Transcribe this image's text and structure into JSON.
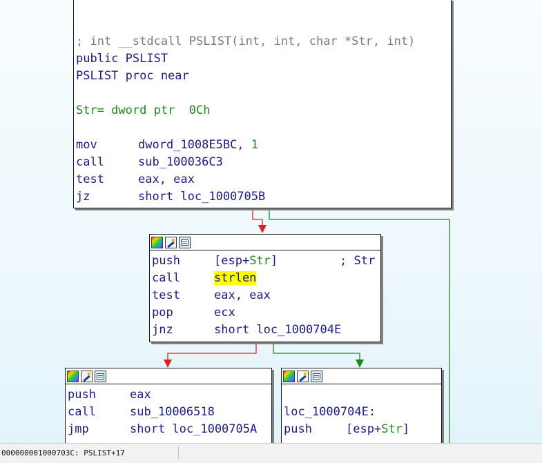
{
  "graph": {
    "top_node": {
      "signature": "; int __stdcall PSLIST(int, int, char *Str, int)",
      "public_line": "public PSLIST",
      "proc_line": "PSLIST proc near",
      "var_name": "Str= dword ptr  ",
      "var_offset": "0Ch",
      "instructions": [
        {
          "mnemonic": "mov",
          "operands": "dword_1008E5BC, ",
          "operand_tail": "1"
        },
        {
          "mnemonic": "call",
          "operands": "sub_100036C3"
        },
        {
          "mnemonic": "test",
          "operands": "eax, eax"
        },
        {
          "mnemonic": "jz",
          "operands": "short loc_1000705B"
        }
      ]
    },
    "mid_node": {
      "instructions": [
        {
          "mnemonic": "push",
          "operands_pre": "[esp+",
          "operands_str": "Str",
          "operands_post": "]",
          "comment_pre": "; ",
          "comment_str": "Str"
        },
        {
          "mnemonic": "call",
          "operands": "strlen"
        },
        {
          "mnemonic": "test",
          "operands": "eax, eax"
        },
        {
          "mnemonic": "pop",
          "operands": "ecx"
        },
        {
          "mnemonic": "jnz",
          "operands": "short loc_1000704E"
        }
      ]
    },
    "left_node": {
      "instructions": [
        {
          "mnemonic": "push",
          "operands": "eax"
        },
        {
          "mnemonic": "call",
          "operands": "sub_10006518"
        },
        {
          "mnemonic": "jmp",
          "operands": "short loc_1000705A"
        }
      ]
    },
    "right_node": {
      "label": "loc_1000704E:",
      "instructions": [
        {
          "mnemonic": "push",
          "operands_pre": "[esp+",
          "operands_str": "Str",
          "operands_post": "]"
        }
      ]
    },
    "toolbar_icons": [
      "color-icon",
      "rename-icon",
      "graph-icon"
    ],
    "colors": {
      "code": "#1b1b8a",
      "comment": "#7a7a7a",
      "green": "#1a8a1a",
      "highlight": "#ffff00",
      "edge_true": "#1a8a1a",
      "edge_false": "#e02020"
    }
  },
  "status_bar": {
    "text": "000000001000703C: PSLIST+17"
  }
}
